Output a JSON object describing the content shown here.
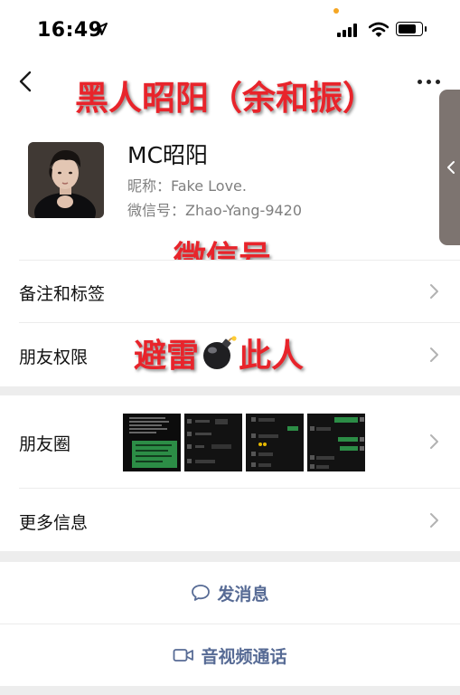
{
  "status_bar": {
    "time": "16:49"
  },
  "overlays": {
    "title": "黑人昭阳（余和振）",
    "wechat_id_caption": "微信号",
    "warning_left": "避雷",
    "warning_right": "此人"
  },
  "profile": {
    "name": "MC昭阳",
    "nickname": "昵称：Fake Love.",
    "wechat_id": "微信号：Zhao-Yang-9420"
  },
  "menu": {
    "remarks_tags": "备注和标签",
    "friend_permissions": "朋友权限",
    "moments": "朋友圈",
    "more_info": "更多信息"
  },
  "actions": {
    "send_message": "发消息",
    "av_call": "音视频通话"
  },
  "icons": {
    "back": "chevron-left-icon",
    "more": "ellipsis-icon",
    "location": "location-arrow-icon",
    "signal": "cellular-signal-icon",
    "wifi": "wifi-icon",
    "battery": "battery-icon",
    "chevron": "chevron-right-icon",
    "message": "chat-bubble-icon",
    "video": "video-camera-icon",
    "bomb": "bomb-emoji"
  },
  "colors": {
    "overlay_text": "#e8242b",
    "action_text": "#576b95",
    "secondary_text": "#7f7f7f",
    "section_gap": "#ededed"
  }
}
